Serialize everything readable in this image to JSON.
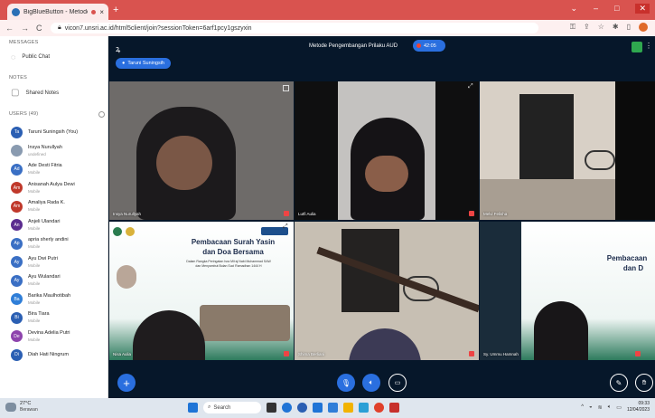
{
  "browser": {
    "tab_title": "BigBlueButton - Metode Pe",
    "url": "vicon7.unsri.ac.id/html5client/join?sessionToken=6arf1pcy1gszyxin"
  },
  "sidebar": {
    "messages_header": "MESSAGES",
    "public_chat": "Public Chat",
    "notes_header": "NOTES",
    "shared_notes": "Shared Notes",
    "users_header": "USERS (49)",
    "users": [
      {
        "initials": "Ta",
        "name": "Taruni Suningsih (You)",
        "sub": "",
        "color": "#2b5fb3"
      },
      {
        "initials": "",
        "name": "Insya Nurullyah",
        "sub": "undefined",
        "color": "#8a9bb0"
      },
      {
        "initials": "Ad",
        "name": "Ade Desti Fitria",
        "sub": "Mobile",
        "color": "#3a6fc4"
      },
      {
        "initials": "Am",
        "name": "Anisanah Aulya Dewi",
        "sub": "Mobile",
        "color": "#c0392b"
      },
      {
        "initials": "Am",
        "name": "Amaliya Rada K.",
        "sub": "Mobile",
        "color": "#c0392b"
      },
      {
        "initials": "An",
        "name": "Anjeli Ulandari",
        "sub": "Mobile",
        "color": "#5b2c8f"
      },
      {
        "initials": "Ap",
        "name": "apria sherly andini",
        "sub": "Mobile",
        "color": "#3a6fc4"
      },
      {
        "initials": "Ay",
        "name": "Ayu Dwi Putri",
        "sub": "Mobile",
        "color": "#3a6fc4"
      },
      {
        "initials": "Ay",
        "name": "Ayu Wulandari",
        "sub": "Mobile",
        "color": "#3a6fc4"
      },
      {
        "initials": "Ba",
        "name": "Barika Maulhotibah",
        "sub": "Mobile",
        "color": "#2f7ed8"
      },
      {
        "initials": "Bi",
        "name": "Bira Tiara",
        "sub": "Mobile",
        "color": "#2b5fb3"
      },
      {
        "initials": "De",
        "name": "Devina Adelia Putri",
        "sub": "Mobile",
        "color": "#8e44ad"
      },
      {
        "initials": "Di",
        "name": "Diah Hati Ningrum",
        "sub": "",
        "color": "#2b5fb3"
      }
    ]
  },
  "meeting": {
    "title": "Metode Pengembangan Prilaku AUD",
    "timer": "42:05",
    "presenter": "Taruni Suningsih"
  },
  "tiles": [
    {
      "name": "Insya Nurullyah"
    },
    {
      "name": "Lutfi Aulia"
    },
    {
      "name": "Melvi Felisha"
    },
    {
      "name": "Nisa Aulia"
    },
    {
      "name": "Shima Berliani"
    },
    {
      "name": "Sy. Ummu Hamnah"
    }
  ],
  "slide": {
    "title_line1": "Pembacaan Surah Yasin",
    "title_line2": "dan Doa Bersama",
    "subtitle1": "Dalam Rangka Peringatan Isra Mi'raj Nabi Muhammad SAW",
    "subtitle2": "dan Menyambut Bulan Suci Ramadhan 1444 H",
    "right_title1": "Pembacaan",
    "right_title2": "dan D"
  },
  "taskbar": {
    "temp": "27°C",
    "condition": "Berawan",
    "search": "Search",
    "time": "09:33",
    "date": "12/04/2023"
  },
  "colors": {
    "accent": "#2a6fdf",
    "main_bg": "#06172a",
    "tab_bar": "#d9534f"
  }
}
